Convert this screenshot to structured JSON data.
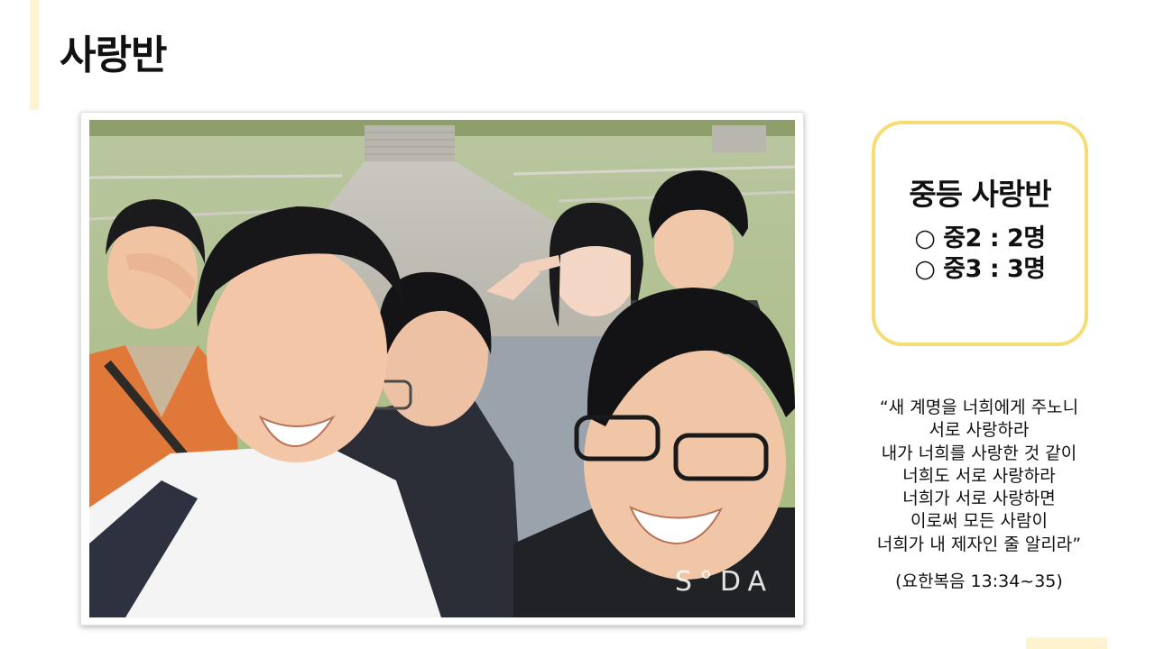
{
  "slide": {
    "title": "사랑반"
  },
  "photo": {
    "description_icon": "group-selfie-photo",
    "watermark": "S°DA"
  },
  "info_box": {
    "title": "중등 사랑반",
    "items": [
      {
        "bullet": "○",
        "text": "중2 : 2명"
      },
      {
        "bullet": "○",
        "text": "중3 : 3명"
      }
    ]
  },
  "verse": {
    "lines": [
      "“새 계명을 너희에게 주노니",
      "서로 사랑하라",
      "내가 너희를 사랑한 것 같이",
      "너희도 서로 사랑하라",
      "너희가 서로 사랑하면",
      "이로써 모든 사람이",
      "너희가 내 제자인 줄 알리라”"
    ],
    "reference": "(요한복음 13:34~35)"
  },
  "colors": {
    "accent_light": "#fff3cf",
    "box_border": "#f6dc75"
  }
}
